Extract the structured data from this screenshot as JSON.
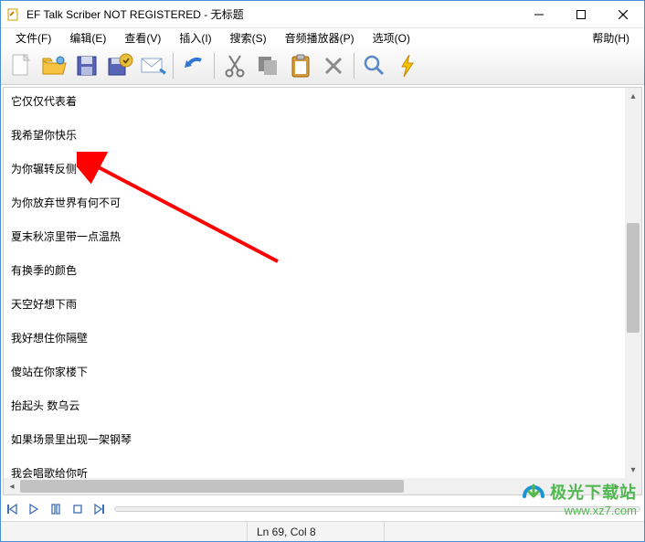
{
  "window": {
    "title": "EF Talk Scriber NOT REGISTERED - 无标题"
  },
  "menu": {
    "file": "文件(F)",
    "edit": "编辑(E)",
    "view": "查看(V)",
    "insert": "插入(I)",
    "search": "搜索(S)",
    "audio": "音频播放器(P)",
    "options": "选项(O)",
    "help": "帮助(H)"
  },
  "toolbar_icons": {
    "new": "new-file-icon",
    "open": "open-folder-icon",
    "save": "save-icon",
    "save_all": "save-all-icon",
    "mail": "mail-icon",
    "undo": "undo-icon",
    "cut": "cut-icon",
    "copy": "copy-icon",
    "paste": "paste-icon",
    "delete": "delete-icon",
    "find": "find-icon",
    "bolt": "bolt-icon"
  },
  "content_lines": [
    "它仅仅代表着",
    "我希望你快乐",
    "为你辗转反侧",
    "为你放弃世界有何不可",
    "夏末秋凉里带一点温热",
    "有换季的颜色",
    "天空好想下雨",
    "我好想住你隔壁",
    "傻站在你家楼下",
    "抬起头 数乌云",
    "如果场景里出现一架钢琴",
    "我会唱歌给你听"
  ],
  "status": {
    "position": "Ln 69, Col 8"
  },
  "watermark": {
    "brand": "极光下载站",
    "url": "www.xz7.com"
  }
}
